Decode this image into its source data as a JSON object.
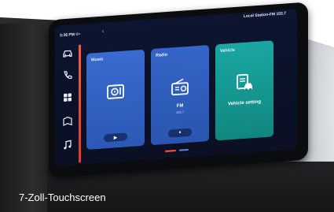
{
  "caption": "7-Zoll-Touchscreen",
  "status": {
    "time": "3:36 PM",
    "station": "Local Station-FM 103.7"
  },
  "sidebar": {
    "items": [
      {
        "icon": "car-icon"
      },
      {
        "icon": "phone-icon"
      },
      {
        "icon": "apps-grid-icon"
      },
      {
        "icon": "navigation-icon"
      },
      {
        "icon": "music-note-icon"
      }
    ]
  },
  "cards": {
    "music": {
      "title": "Music",
      "icon": "music-player-icon",
      "button": "▶"
    },
    "radio": {
      "title": "Radio",
      "icon": "radio-icon",
      "freq": "FM",
      "sub": "103.7",
      "button": "⏸"
    },
    "vehicle": {
      "title": "Vehicle",
      "icon": "vehicle-settings-icon",
      "label": "Vehicle setting"
    }
  },
  "colors": {
    "accent": "#ff5a3c",
    "music_card": "#3a6bd0",
    "radio_card": "#3565c8",
    "vehicle_card": "#1aa7a3",
    "screen_bg": "#0d1530"
  }
}
